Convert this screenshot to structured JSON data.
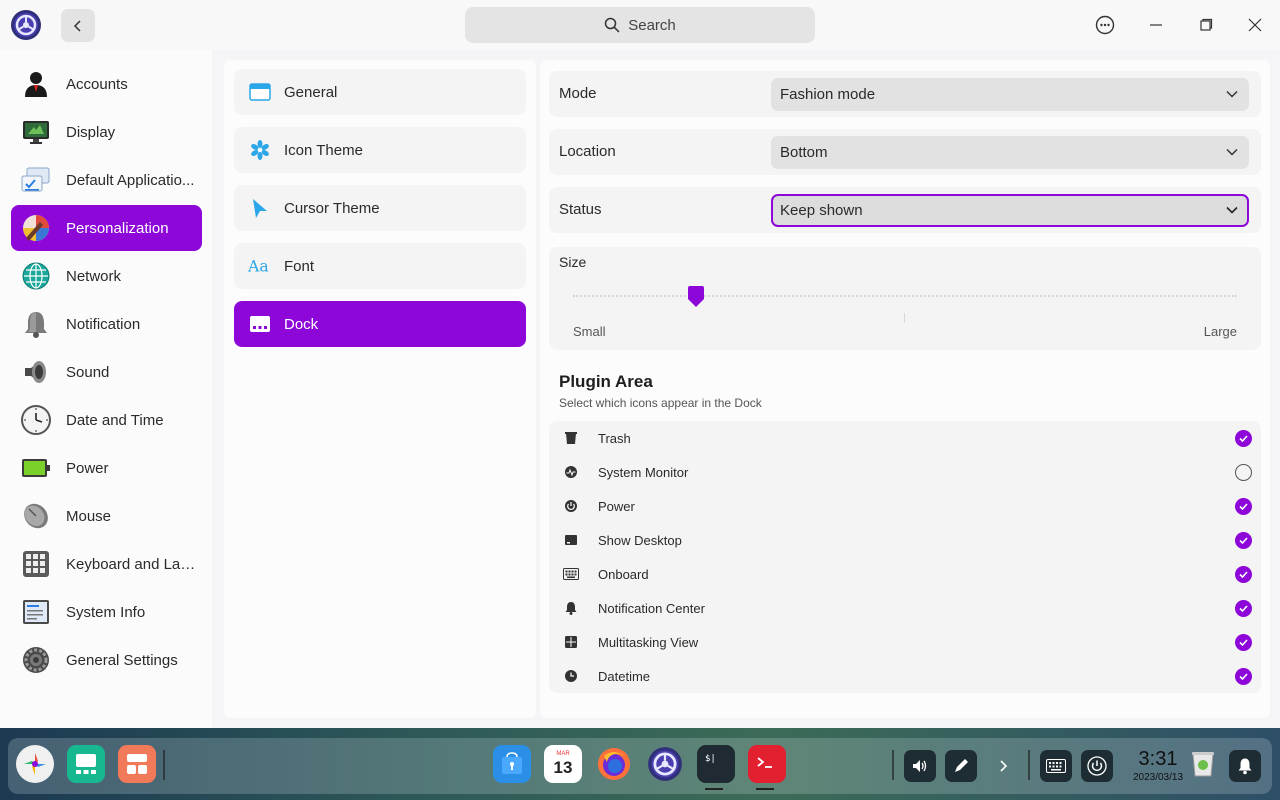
{
  "titlebar": {
    "search_placeholder": "Search"
  },
  "sidebar": {
    "items": [
      {
        "label": "Accounts",
        "icon": "accounts-icon",
        "active": false
      },
      {
        "label": "Display",
        "icon": "display-icon",
        "active": false
      },
      {
        "label": "Default Applicatio...",
        "icon": "default-apps-icon",
        "active": false
      },
      {
        "label": "Personalization",
        "icon": "personalization-icon",
        "active": true
      },
      {
        "label": "Network",
        "icon": "network-icon",
        "active": false
      },
      {
        "label": "Notification",
        "icon": "bell-icon",
        "active": false
      },
      {
        "label": "Sound",
        "icon": "speaker-icon",
        "active": false
      },
      {
        "label": "Date and Time",
        "icon": "clock-icon",
        "active": false
      },
      {
        "label": "Power",
        "icon": "battery-icon",
        "active": false
      },
      {
        "label": "Mouse",
        "icon": "mouse-icon",
        "active": false
      },
      {
        "label": "Keyboard and Lan...",
        "icon": "keyboard-icon",
        "active": false
      },
      {
        "label": "System Info",
        "icon": "system-info-icon",
        "active": false
      },
      {
        "label": "General Settings",
        "icon": "gear-icon",
        "active": false
      }
    ]
  },
  "subnav": {
    "items": [
      {
        "label": "General",
        "icon": "window-icon",
        "active": false
      },
      {
        "label": "Icon Theme",
        "icon": "snowflake-icon",
        "active": false
      },
      {
        "label": "Cursor Theme",
        "icon": "cursor-icon",
        "active": false
      },
      {
        "label": "Font",
        "icon": "font-icon",
        "active": false
      },
      {
        "label": "Dock",
        "icon": "dock-icon",
        "active": true
      }
    ]
  },
  "dock_settings": {
    "mode": {
      "label": "Mode",
      "value": "Fashion mode"
    },
    "location": {
      "label": "Location",
      "value": "Bottom"
    },
    "status": {
      "label": "Status",
      "value": "Keep shown"
    },
    "size": {
      "label": "Size",
      "min_label": "Small",
      "max_label": "Large",
      "value_fraction": 0.185
    }
  },
  "plugin_area": {
    "title": "Plugin Area",
    "subtitle": "Select which icons appear in the Dock",
    "items": [
      {
        "label": "Trash",
        "icon": "trash-icon",
        "checked": true
      },
      {
        "label": "System Monitor",
        "icon": "system-monitor-icon",
        "checked": false
      },
      {
        "label": "Power",
        "icon": "power-icon",
        "checked": true
      },
      {
        "label": "Show Desktop",
        "icon": "show-desktop-icon",
        "checked": true
      },
      {
        "label": "Onboard",
        "icon": "keyboard-icon",
        "checked": true
      },
      {
        "label": "Notification Center",
        "icon": "bell-icon",
        "checked": true
      },
      {
        "label": "Multitasking View",
        "icon": "multitasking-icon",
        "checked": true
      },
      {
        "label": "Datetime",
        "icon": "clock-icon",
        "checked": true
      }
    ]
  },
  "taskbar": {
    "calendar_month": "MAR",
    "calendar_day": "13",
    "clock_time": "3:31",
    "clock_date": "2023/03/13"
  },
  "colors": {
    "accent": "#8d07d8"
  }
}
